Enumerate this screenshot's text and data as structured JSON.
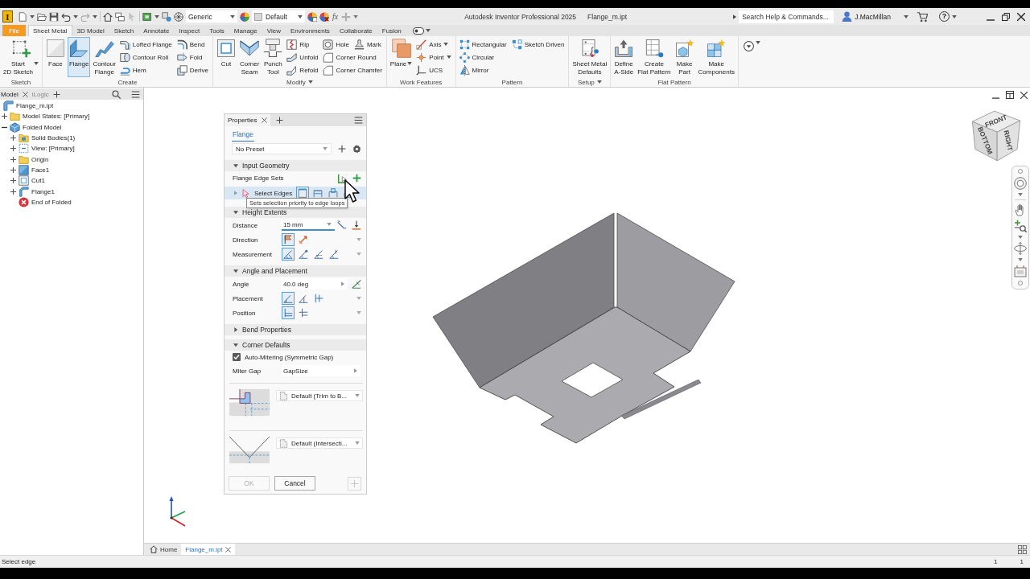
{
  "window": {
    "logo": "I",
    "title": "Autodesk Inventor Professional 2025",
    "document": "Flange_m.ipt",
    "search": {
      "placeholder": "Search Help & Commands..."
    },
    "user": "J.MacMillan",
    "help": "?"
  },
  "quick_access": {
    "material": "Generic",
    "appearance": "Default",
    "parameters": "fx"
  },
  "ribbon": {
    "tabs": [
      {
        "label": "File",
        "kind": "menu",
        "selected": false
      },
      {
        "label": "Sheet Metal",
        "kind": "tab",
        "selected": true
      },
      {
        "label": "3D Model",
        "kind": "tab",
        "selected": false
      },
      {
        "label": "Sketch",
        "kind": "tab",
        "selected": false
      },
      {
        "label": "Annotate",
        "kind": "tab",
        "selected": false
      },
      {
        "label": "Inspect",
        "kind": "tab",
        "selected": false
      },
      {
        "label": "Tools",
        "kind": "tab",
        "selected": false
      },
      {
        "label": "Manage",
        "kind": "tab",
        "selected": false
      },
      {
        "label": "View",
        "kind": "tab",
        "selected": false
      },
      {
        "label": "Environments",
        "kind": "tab",
        "selected": false
      },
      {
        "label": "Collaborate",
        "kind": "tab",
        "selected": false
      },
      {
        "label": "Fusion",
        "kind": "tab",
        "selected": false
      }
    ],
    "panels": [
      {
        "title": "Sketch",
        "menu": false,
        "items": [
          {
            "kind": "large",
            "label": "Start\n2D Sketch",
            "active": false,
            "dropdown": true
          }
        ]
      },
      {
        "title": "Create",
        "menu": false,
        "items": [
          {
            "kind": "large",
            "label": "Face",
            "active": false
          },
          {
            "kind": "large",
            "label": "Flange",
            "active": true
          },
          {
            "kind": "large",
            "label": "Contour\nFlange",
            "active": false
          },
          {
            "kind": "stack",
            "rows": [
              [
                {
                  "label": "Lofted Flange"
                }
              ],
              [
                {
                  "label": "Contour Roll"
                }
              ],
              [
                {
                  "label": "Hem"
                }
              ]
            ]
          },
          {
            "kind": "stack",
            "rows": [
              [
                {
                  "label": "Bend"
                }
              ],
              [
                {
                  "label": "Fold"
                }
              ],
              [
                {
                  "label": "Derive"
                }
              ]
            ]
          }
        ]
      },
      {
        "title": "Modify",
        "menu": true,
        "items": [
          {
            "kind": "large",
            "label": "Cut",
            "active": false
          },
          {
            "kind": "large",
            "label": "Corner\nSeam",
            "active": false
          },
          {
            "kind": "large",
            "label": "Punch\nTool",
            "active": false
          },
          {
            "kind": "stack",
            "rows": [
              [
                {
                  "label": "Rip"
                }
              ],
              [
                {
                  "label": "Unfold"
                }
              ],
              [
                {
                  "label": "Refold"
                }
              ]
            ]
          },
          {
            "kind": "stack",
            "rows": [
              [
                {
                  "label": "Hole"
                },
                {
                  "label": "Mark"
                }
              ],
              [
                {
                  "label": "Corner Round"
                }
              ],
              [
                {
                  "label": "Corner Chamfer"
                }
              ]
            ]
          }
        ]
      },
      {
        "title": "Work Features",
        "menu": false,
        "items": [
          {
            "kind": "large",
            "label": "Plane",
            "active": false,
            "dropdown": true
          },
          {
            "kind": "stack",
            "rows": [
              [
                {
                  "label": "Axis",
                  "dropdown": true
                }
              ],
              [
                {
                  "label": "Point",
                  "dropdown": true
                }
              ],
              [
                {
                  "label": "UCS"
                }
              ]
            ]
          }
        ]
      },
      {
        "title": "Pattern",
        "menu": false,
        "items": [
          {
            "kind": "stack",
            "rows": [
              [
                {
                  "label": "Rectangular"
                }
              ],
              [
                {
                  "label": "Circular"
                }
              ],
              [
                {
                  "label": "Mirror"
                }
              ]
            ]
          },
          {
            "kind": "stack",
            "rows": [
              [
                {
                  "label": "Sketch Driven"
                }
              ]
            ]
          }
        ]
      },
      {
        "title": "Setup",
        "menu": true,
        "items": [
          {
            "kind": "large",
            "label": "Sheet Metal\nDefaults",
            "active": false
          }
        ]
      },
      {
        "title": "Flat Pattern",
        "menu": false,
        "items": [
          {
            "kind": "large",
            "label": "Define\nA-Side",
            "active": false
          },
          {
            "kind": "large",
            "label": "Create\nFlat Pattern",
            "active": false
          },
          {
            "kind": "large",
            "label": "Make\nPart",
            "active": false
          },
          {
            "kind": "large",
            "label": "Make\nComponents",
            "active": false
          }
        ]
      }
    ]
  },
  "browser": {
    "tabs": [
      {
        "label": "Model",
        "selected": true
      },
      {
        "label": "iLogic",
        "selected": false
      }
    ],
    "tree": [
      {
        "label": "Flange_m.ipt",
        "children": [
          {
            "label": "Model States: [Primary]",
            "expanded": false
          },
          {
            "label": "Folded Model",
            "expanded": true,
            "children": [
              {
                "label": "Solid Bodies(1)",
                "expanded": false
              },
              {
                "label": "View: [Primary]",
                "expanded": false
              },
              {
                "label": "Origin",
                "expanded": false
              },
              {
                "label": "Face1",
                "expanded": false
              },
              {
                "label": "Cut1",
                "expanded": false
              },
              {
                "label": "Flange1",
                "expanded": false
              },
              {
                "label": "End of Folded"
              }
            ]
          }
        ]
      }
    ]
  },
  "properties": {
    "tab": "Properties",
    "feature": "Flange",
    "preset": "No Preset",
    "sections": [
      {
        "title": "Input Geometry",
        "expanded": true,
        "rows": [
          {
            "kind": "edge_sets",
            "label": "Flange Edge Sets"
          },
          {
            "kind": "selector",
            "label": "Select Edges",
            "selected": true,
            "options": [
              {
                "selected": true
              },
              {
                "selected": false
              },
              {
                "selected": false
              },
              {
                "selected": false
              }
            ]
          }
        ]
      },
      {
        "title": "Height Extents",
        "expanded": true,
        "rows": [
          {
            "kind": "field",
            "label": "Distance",
            "value": "15 mm",
            "focused": true
          },
          {
            "kind": "options",
            "label": "Direction",
            "options": [
              {
                "selected": true
              },
              {
                "selected": false
              }
            ]
          },
          {
            "kind": "options",
            "label": "Measurement",
            "options": [
              {
                "selected": true
              },
              {
                "selected": false
              },
              {
                "selected": false
              },
              {
                "selected": false
              }
            ]
          }
        ]
      },
      {
        "title": "Angle and Placement",
        "expanded": true,
        "rows": [
          {
            "kind": "field",
            "label": "Angle",
            "value": "40.0 deg",
            "focused": false
          },
          {
            "kind": "options",
            "label": "Placement",
            "options": [
              {
                "selected": true
              },
              {
                "selected": false
              },
              {
                "selected": false
              }
            ]
          },
          {
            "kind": "options",
            "label": "Position",
            "options": [
              {
                "selected": true
              },
              {
                "selected": false
              }
            ]
          }
        ]
      },
      {
        "title": "Bend Properties",
        "expanded": false
      },
      {
        "title": "Corner Defaults",
        "expanded": true,
        "rows": [
          {
            "kind": "checkbox",
            "label": "Auto-Mitering (Symmetric Gap)",
            "checked": true
          },
          {
            "kind": "field",
            "label": "Miter Gap",
            "value": "GapSize",
            "focused": false
          },
          {
            "kind": "relief",
            "value": "Default (Trim to B..."
          },
          {
            "kind": "relief",
            "value": "Default (Intersecti..."
          }
        ]
      }
    ],
    "tooltip": "Sets selection priority to edge loops",
    "buttons": [
      {
        "kind": "text",
        "label": "OK",
        "disabled": true
      },
      {
        "kind": "text",
        "label": "Cancel",
        "disabled": false
      },
      {
        "kind": "icon",
        "disabled": true
      }
    ]
  },
  "view_cube": {
    "faces": [
      "FRONT",
      "BOTTOM",
      "RIGHT"
    ]
  },
  "document_tabs": [
    {
      "kind": "home",
      "label": "Home",
      "selected": false
    },
    {
      "kind": "document",
      "label": "Flange_m.ipt",
      "selected": true
    }
  ],
  "status_bar": {
    "message": "Select edge",
    "fields": [
      "1",
      "1"
    ]
  }
}
